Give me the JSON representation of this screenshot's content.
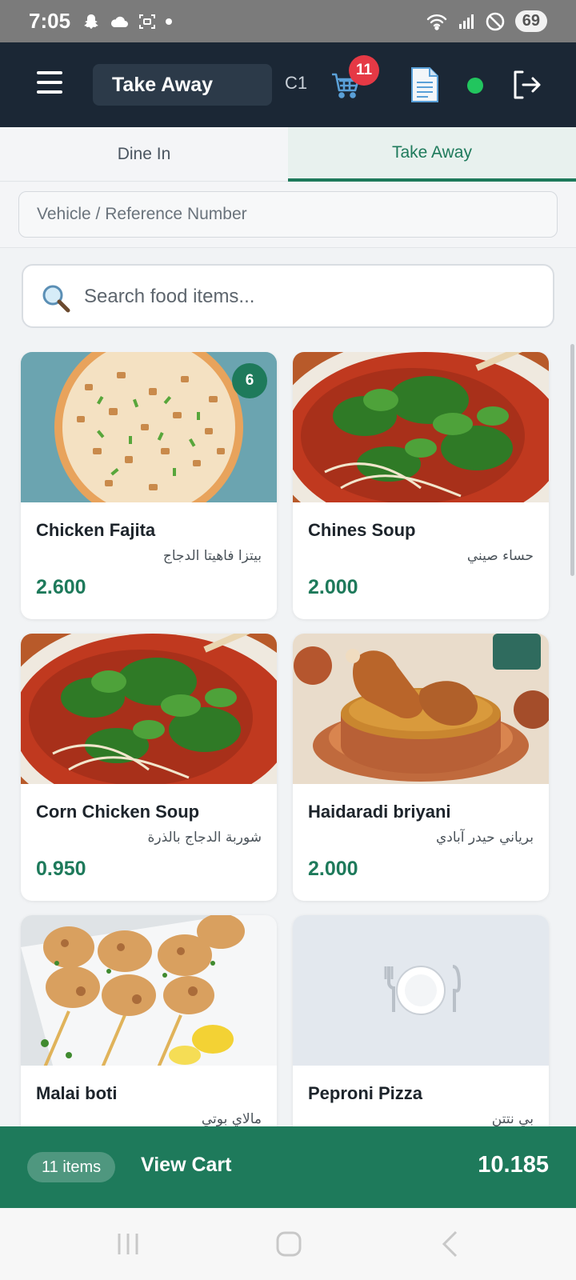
{
  "status_bar": {
    "time": "7:05",
    "battery": "69"
  },
  "header": {
    "order_mode": "Take Away",
    "table_code": "C1",
    "cart_count": "11",
    "online_color": "#22c55e"
  },
  "tabs": [
    {
      "label": "Dine In",
      "active": false
    },
    {
      "label": "Take Away",
      "active": true
    }
  ],
  "reference": {
    "placeholder": "Vehicle / Reference Number",
    "value": ""
  },
  "search": {
    "placeholder": "Search food items...",
    "value": ""
  },
  "menu_items": [
    {
      "name": "Chicken Fajita",
      "arabic": "بيتزا فاهيتا الدجاج",
      "price": "2.600",
      "qty": "6",
      "image": "pizza"
    },
    {
      "name": "Chines Soup",
      "arabic": "حساء صيني",
      "price": "2.000",
      "qty": null,
      "image": "soup"
    },
    {
      "name": "Corn Chicken Soup",
      "arabic": "شوربة الدجاج بالذرة",
      "price": "0.950",
      "qty": null,
      "image": "soup"
    },
    {
      "name": "Haidaradi briyani",
      "arabic": "برياني حيدر آبادي",
      "price": "2.000",
      "qty": null,
      "image": "biryani"
    },
    {
      "name": "Malai boti",
      "arabic": "مالاي بوتي",
      "price": "",
      "qty": null,
      "image": "skewers"
    },
    {
      "name": "Peproni Pizza",
      "arabic": "بي نتتن",
      "price": "",
      "qty": null,
      "image": "placeholder-plate"
    }
  ],
  "cart_bar": {
    "items_label": "11 items",
    "view_label": "View Cart",
    "total": "10.185"
  },
  "colors": {
    "accent": "#1e7a5b",
    "header_bg": "#1b2735",
    "badge_red": "#e53945"
  }
}
